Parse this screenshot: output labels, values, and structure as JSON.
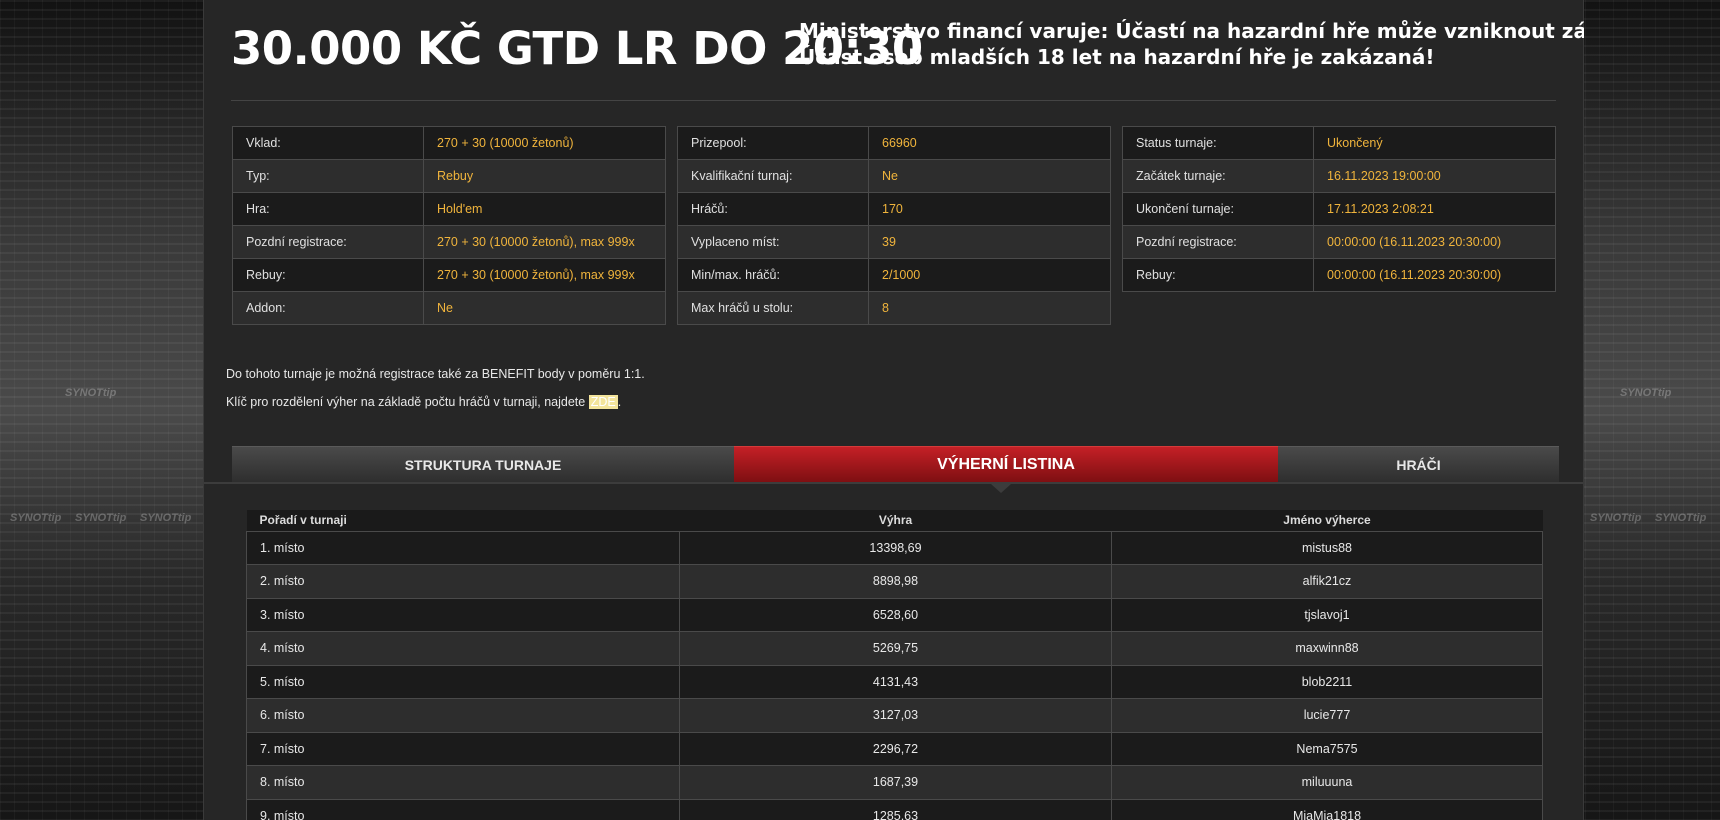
{
  "title": "30.000 KČ GTD LR DO 20:30",
  "warning": {
    "line1": "Ministerstvo financí varuje: Účastí na hazardní hře může vzniknout závislost!",
    "line2": "Účast osob mladších 18 let na hazardní hře je zakázaná!"
  },
  "brand": "SYNOTtip",
  "info": {
    "col1": [
      {
        "label": "Vklad:",
        "value": "270 + 30 (10000 žetonů)"
      },
      {
        "label": "Typ:",
        "value": "Rebuy"
      },
      {
        "label": "Hra:",
        "value": "Hold'em"
      },
      {
        "label": "Pozdní registrace:",
        "value": "270 + 30 (10000 žetonů), max 999x"
      },
      {
        "label": "Rebuy:",
        "value": "270 + 30 (10000 žetonů), max 999x"
      },
      {
        "label": "Addon:",
        "value": "Ne"
      }
    ],
    "col2": [
      {
        "label": "Prizepool:",
        "value": "66960"
      },
      {
        "label": "Kvalifikační turnaj:",
        "value": "Ne"
      },
      {
        "label": "Hráčů:",
        "value": "170"
      },
      {
        "label": "Vyplaceno míst:",
        "value": "39"
      },
      {
        "label": "Min/max. hráčů:",
        "value": "2/1000"
      },
      {
        "label": "Max hráčů u stolu:",
        "value": "8"
      }
    ],
    "col3": [
      {
        "label": "Status turnaje:",
        "value": "Ukončený"
      },
      {
        "label": "Začátek turnaje:",
        "value": "16.11.2023 19:00:00"
      },
      {
        "label": "Ukončení turnaje:",
        "value": "17.11.2023 2:08:21"
      },
      {
        "label": "Pozdní registrace:",
        "value": "00:00:00 (16.11.2023 20:30:00)"
      },
      {
        "label": "Rebuy:",
        "value": "00:00:00 (16.11.2023 20:30:00)"
      }
    ]
  },
  "notes": {
    "benefit": "Do tohoto turnaje je možná registrace také za BENEFIT body v poměru 1:1.",
    "key_prefix": "Klíč pro rozdělení výher na základě počtu hráčů v turnaji, najdete",
    "key_link": "ZDE",
    "key_suffix": "."
  },
  "tabs": [
    {
      "label": "STRUKTURA TURNAJE",
      "active": false
    },
    {
      "label": "VÝHERNÍ LISTINA",
      "active": true
    },
    {
      "label": "HRÁČI",
      "active": false
    }
  ],
  "prize_table": {
    "headers": [
      "Pořadí v turnaji",
      "Výhra",
      "Jméno výherce"
    ],
    "rows": [
      [
        "1. místo",
        "13398,69",
        "mistus88"
      ],
      [
        "2. místo",
        "8898,98",
        "alfik21cz"
      ],
      [
        "3. místo",
        "6528,60",
        "tjslavoj1"
      ],
      [
        "4. místo",
        "5269,75",
        "maxwinn88"
      ],
      [
        "5. místo",
        "4131,43",
        "blob2211"
      ],
      [
        "6. místo",
        "3127,03",
        "lucie777"
      ],
      [
        "7. místo",
        "2296,72",
        "Nema7575"
      ],
      [
        "8. místo",
        "1687,39",
        "miluuuna"
      ],
      [
        "9. místo",
        "1285,63",
        "MiaMia1818"
      ]
    ]
  },
  "colors": {
    "accent_value": "#f0b43c",
    "active_tab": "#c42026",
    "page_bg": "#262626"
  }
}
